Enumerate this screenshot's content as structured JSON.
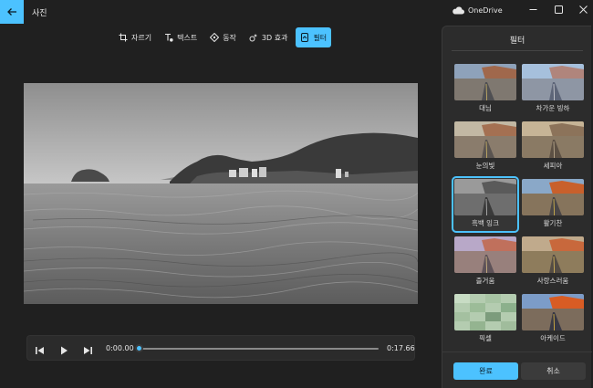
{
  "window": {
    "title": "사진",
    "onedrive_label": "OneDrive"
  },
  "toolbar": {
    "tools": [
      {
        "label": "자르기",
        "icon": "crop-icon",
        "active": false
      },
      {
        "label": "텍스트",
        "icon": "text-icon",
        "active": false
      },
      {
        "label": "동작",
        "icon": "motion-icon",
        "active": false
      },
      {
        "label": "3D 효과",
        "icon": "3d-effects-icon",
        "active": false
      },
      {
        "label": "필터",
        "icon": "filter-icon",
        "active": true
      }
    ]
  },
  "playback": {
    "current_time": "0:00.00",
    "total_time": "0:17.66",
    "progress": 0
  },
  "panel": {
    "title": "필터",
    "filters": [
      {
        "label": "대님",
        "selected": false
      },
      {
        "label": "차가운 빙하",
        "selected": false
      },
      {
        "label": "눈의빛",
        "selected": false
      },
      {
        "label": "세피아",
        "selected": false
      },
      {
        "label": "흑백 잉크",
        "selected": true
      },
      {
        "label": "활기찬",
        "selected": false
      },
      {
        "label": "즐거움",
        "selected": false
      },
      {
        "label": "사랑스러움",
        "selected": false
      },
      {
        "label": "픽셀",
        "selected": false
      },
      {
        "label": "아케이드",
        "selected": false
      }
    ],
    "done_label": "완료",
    "cancel_label": "취소"
  },
  "colors": {
    "accent": "#4cc2ff",
    "background": "#202020",
    "panel": "#2c2c2c"
  }
}
